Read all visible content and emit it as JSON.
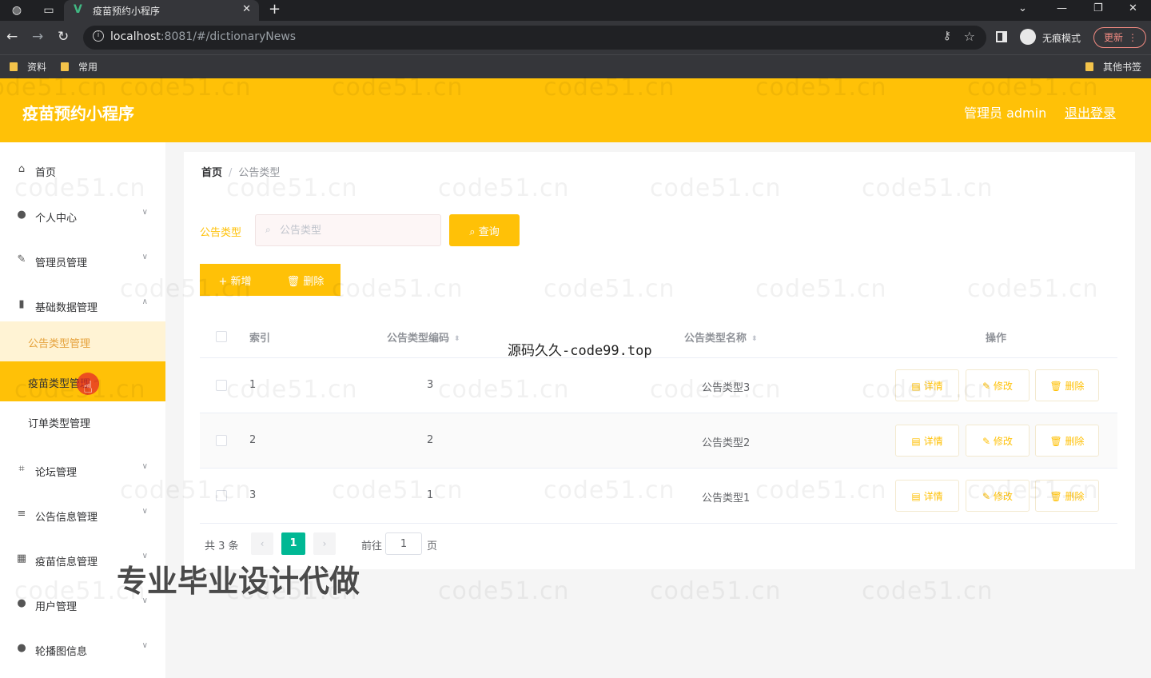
{
  "browser": {
    "tab_title": "疫苗预约小程序",
    "url_host": "localhost",
    "url_rest": ":8081/#/dictionaryNews",
    "incognito_label": "无痕模式",
    "update_label": "更新",
    "bookmarks": [
      "资料",
      "常用",
      "其他书签"
    ]
  },
  "header": {
    "title": "疫苗预约小程序",
    "admin_label": "管理员 admin",
    "logout": "退出登录",
    "color": "#ffc107"
  },
  "sidebar": {
    "items": [
      {
        "label": "首页",
        "icon": "home-icon"
      },
      {
        "label": "个人中心",
        "icon": "user-icon"
      },
      {
        "label": "管理员管理",
        "icon": "edit-icon"
      },
      {
        "label": "基础数据管理",
        "icon": "chart-icon"
      },
      {
        "label": "论坛管理",
        "icon": "crop-icon"
      },
      {
        "label": "公告信息管理",
        "icon": "menu-icon"
      },
      {
        "label": "疫苗信息管理",
        "icon": "grid-icon"
      },
      {
        "label": "用户管理",
        "icon": "user-icon"
      },
      {
        "label": "轮播图信息",
        "icon": "user-icon"
      }
    ],
    "sub_items": [
      "公告类型管理",
      "疫苗类型管理",
      "订单类型管理"
    ]
  },
  "breadcrumb": {
    "home": "首页",
    "current": "公告类型"
  },
  "search": {
    "label": "公告类型",
    "placeholder": "公告类型",
    "button": "查询"
  },
  "actions": {
    "add": "新增",
    "delete": "删除"
  },
  "table": {
    "headers": [
      "索引",
      "公告类型编码",
      "公告类型名称",
      "操作"
    ],
    "rows": [
      {
        "index": "1",
        "code": "3",
        "name": "公告类型3"
      },
      {
        "index": "2",
        "code": "2",
        "name": "公告类型2"
      },
      {
        "index": "3",
        "code": "1",
        "name": "公告类型1"
      }
    ],
    "row_actions": {
      "detail": "详情",
      "edit": "修改",
      "delete": "删除"
    }
  },
  "pagination": {
    "total": "共 3 条",
    "current_page": "1",
    "goto_label": "前往",
    "goto_value": "1",
    "page_unit": "页"
  },
  "overlay": {
    "watermark": "code51.cn",
    "caption": "源码久久-code99.top",
    "banner": "专业毕业设计代做"
  }
}
